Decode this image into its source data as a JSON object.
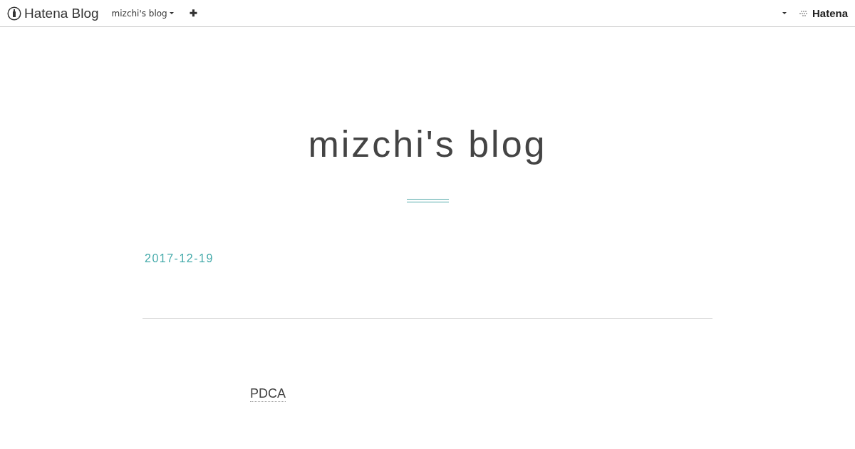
{
  "navbar": {
    "logo": "Hatena Blog",
    "blog_menu": "mizchi's blog",
    "add_button": "✚",
    "brand": "Hatena"
  },
  "header": {
    "title": "mizchi's blog"
  },
  "entry": {
    "date": "2017-12-19",
    "category": "PDCA"
  }
}
